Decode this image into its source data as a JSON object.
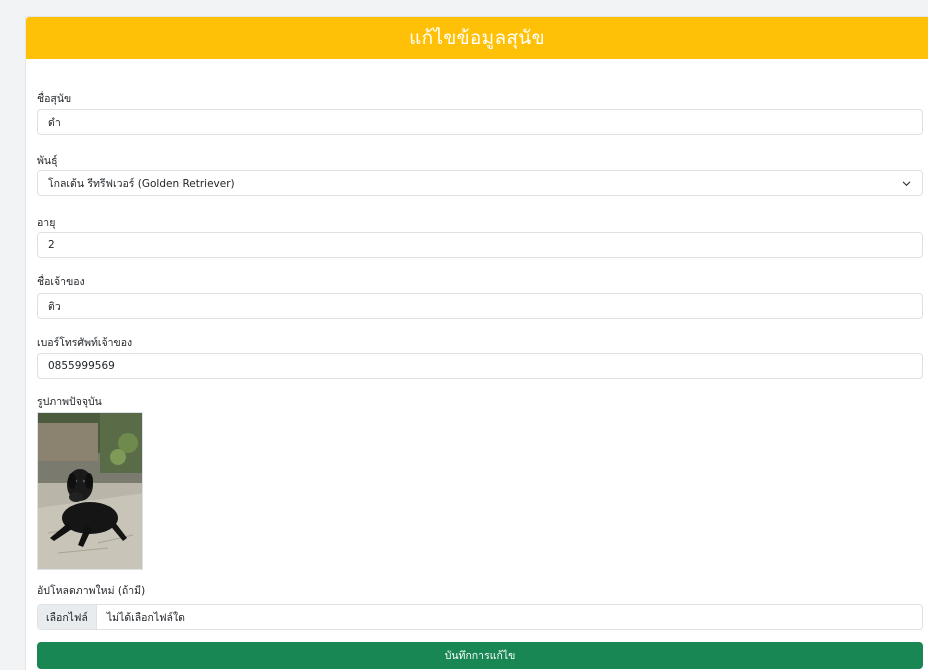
{
  "header": {
    "title": "แก้ไขข้อมูลสุนัข"
  },
  "form": {
    "dog_name": {
      "label": "ชื่อสุนัข",
      "value": "ดำ"
    },
    "breed": {
      "label": "พันธุ์",
      "value": "โกลเด้น รีทรีฟเวอร์ (Golden Retriever)"
    },
    "age": {
      "label": "อายุ",
      "value": "2"
    },
    "owner_name": {
      "label": "ชื่อเจ้าของ",
      "value": "ติว"
    },
    "owner_phone": {
      "label": "เบอร์โทรศัพท์เจ้าของ",
      "value": "0855999569"
    },
    "current_photo": {
      "label": "รูปภาพปัจจุบัน"
    },
    "upload": {
      "label": "อัปโหลดภาพใหม่ (ถ้ามี)",
      "button_label": "เลือกไฟล์",
      "file_status": "ไม่ได้เลือกไฟล์ใด"
    },
    "submit_label": "บันทึกการแก้ไข"
  },
  "colors": {
    "header": "#ffc107",
    "submit": "#198754"
  }
}
